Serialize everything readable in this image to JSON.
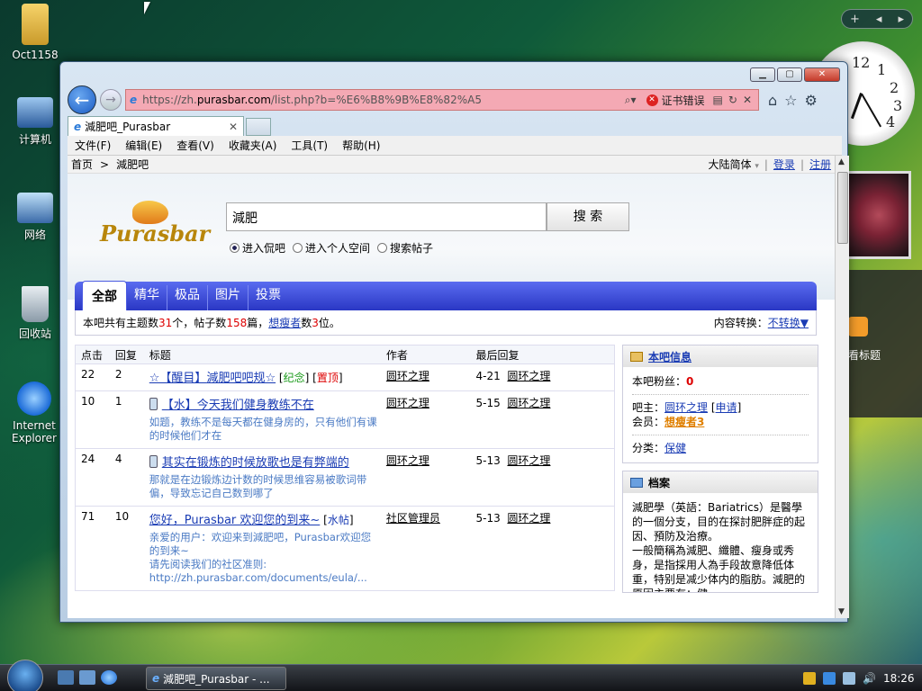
{
  "desktop": {
    "icons": [
      {
        "label": "Oct1158"
      },
      {
        "label": "计算机"
      },
      {
        "label": "网络"
      },
      {
        "label": "回收站"
      },
      {
        "label": "Internet Explorer"
      }
    ],
    "feed_gadget_label": "看标题"
  },
  "clock": {
    "numbers": [
      "12",
      "1",
      "2",
      "3",
      "4"
    ]
  },
  "browser": {
    "url_prefix": "https://zh.",
    "url_domain": "purasbar.com",
    "url_rest": "/list.php?b=%E6%B8%9B%E8%82%A5",
    "cert_error": "证书错误",
    "tab_title": "減肥吧_Purasbar",
    "menu": [
      "文件(F)",
      "编辑(E)",
      "查看(V)",
      "收藏夹(A)",
      "工具(T)",
      "帮助(H)"
    ]
  },
  "page": {
    "breadcrumb_home": "首页",
    "breadcrumb_sep": ">",
    "breadcrumb_current": "減肥吧",
    "lang_select": "大陆简体",
    "login": "登录",
    "register": "注册",
    "logo_text": "Purasbar",
    "search": {
      "value": "減肥",
      "button": "搜 索"
    },
    "radios": [
      {
        "label": "进入侃吧",
        "checked": true
      },
      {
        "label": "进入个人空间",
        "checked": false
      },
      {
        "label": "搜索帖子",
        "checked": false
      }
    ],
    "forum_tabs": [
      "全部",
      "精华",
      "极品",
      "图片",
      "投票"
    ],
    "stats": {
      "prefix": "本吧共有主题数",
      "threads": "31",
      "mid1": "个，帖子数",
      "posts": "158",
      "mid2": "篇，",
      "member_link": "想瘦者",
      "mid3": "数",
      "members": "3",
      "suffix": "位。",
      "convert_label": "内容转换：",
      "convert_link": "不转换▼"
    },
    "table_headers": [
      "点击",
      "回复",
      "标题",
      "作者",
      "最后回复"
    ],
    "threads": [
      {
        "clicks": "22",
        "replies": "2",
        "prefix": "☆【醒目】",
        "title": "減肥吧吧规☆",
        "tags": [
          {
            "text": "纪念",
            "color": "green"
          },
          {
            "text": "置顶",
            "color": "red"
          }
        ],
        "author": "圆环之理",
        "last_date": "4-21",
        "last_user": "圆环之理",
        "preview": "",
        "mobile": false
      },
      {
        "clicks": "10",
        "replies": "1",
        "prefix": "",
        "title": "【水】今天我们健身教练不在",
        "tags": [],
        "author": "圆环之理",
        "last_date": "5-15",
        "last_user": "圆环之理",
        "preview": "如题，教练不是每天都在健身房的，只有他们有课的时候他们才在",
        "mobile": true
      },
      {
        "clicks": "24",
        "replies": "4",
        "prefix": "",
        "title": "其实在锻炼的时候放歌也是有弊端的",
        "tags": [],
        "author": "圆环之理",
        "last_date": "5-13",
        "last_user": "圆环之理",
        "preview": "那就是在边锻炼边计数的时候思维容易被歌词带偏，导致忘记自己数到哪了",
        "mobile": true
      },
      {
        "clicks": "71",
        "replies": "10",
        "prefix": "",
        "title": "您好，Purasbar 欢迎您的到来~",
        "tags": [
          {
            "text": "水帖",
            "color": "blue"
          }
        ],
        "author": "社区管理员",
        "last_date": "5-13",
        "last_user": "圆环之理",
        "preview": "亲爱的用户：欢迎来到減肥吧，Purasbar欢迎您的到来~\n请先阅读我们的社区准则:\nhttp://zh.purasbar.com/documents/eula/...",
        "mobile": false
      }
    ],
    "side_info": {
      "title": "本吧信息",
      "fans_label": "本吧粉丝：",
      "fans_value": "0",
      "owner_label": "吧主：",
      "owner": "圆环之理",
      "apply": "申请",
      "member_label": "会员：",
      "member_link": "想瘦者3",
      "category_label": "分类：",
      "category": "保健"
    },
    "side_archive": {
      "title": "档案",
      "text": "減肥學（英語：Bariatrics）是醫學的一個分支，目的在探討肥胖症的起因、預防及治療。\n一般簡稱為減肥、纖體、瘦身或秀身，是指採用人為手段故意降低体重，特别是减少体内的脂肪。減肥的原因主要有：健..."
    }
  },
  "taskbar": {
    "task_label": "減肥吧_Purasbar - ...",
    "time": "18:26"
  }
}
